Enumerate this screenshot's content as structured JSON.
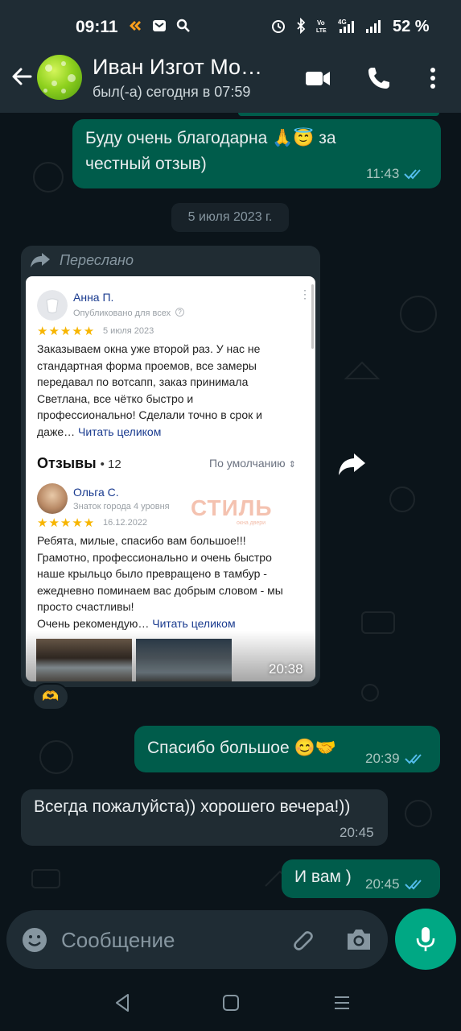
{
  "status_bar": {
    "time": "09:11",
    "battery": "52 %"
  },
  "header": {
    "contact_name": "Иван Изгот Мо…",
    "last_seen": "был(-а) сегодня в 07:59"
  },
  "messages": {
    "m1": {
      "text_line1": "Буду очень благодарна 🙏😇 за",
      "text_line2": "честный отзыв)",
      "time": "11:43"
    },
    "date_chip": "5 июля 2023 г.",
    "forwarded": {
      "label": "Переслано",
      "time": "20:38",
      "reaction": "🫶",
      "review1": {
        "name": "Анна П.",
        "published": "Опубликовано для всех",
        "stars": "★★★★★",
        "date": "5 июля 2023",
        "lines": [
          "Заказываем окна уже второй раз. У нас не",
          "стандартная форма проемов, все замеры",
          "передавал по вотсапп, заказ принимала",
          "Светлана, все чётко быстро и",
          "профессионально! Сделали точно в срок и"
        ],
        "last_line": "даже…",
        "read_more": "Читать целиком"
      },
      "reviews_heading": "Отзывы",
      "reviews_count": "• 12",
      "sort_label": "По умолчанию",
      "review2": {
        "name": "Ольга С.",
        "badge": "Знаток города 4 уровня",
        "stars": "★★★★★",
        "date": "16.12.2022",
        "lines": [
          "Ребята, милые, спасибо вам большое!!!",
          "Грамотно, профессионально и очень быстро",
          "наше крыльцо было превращено в тамбур -",
          "ежедневно поминаем вас добрым словом - мы",
          "просто счастливы!"
        ],
        "last_line": "Очень рекомендую…",
        "read_more": "Читать целиком"
      },
      "watermark": "СТИЛЬ",
      "watermark_sub": "окна двери"
    },
    "m3": {
      "text": "Спасибо большое 😊🤝",
      "time": "20:39"
    },
    "m4": {
      "text": "Всегда пожалуйста)) хорошего вечера!))",
      "time": "20:45"
    },
    "m5": {
      "text": "И вам )",
      "time": "20:45"
    }
  },
  "input": {
    "placeholder": "Сообщение"
  },
  "colors": {
    "outgoing": "#005c4b",
    "incoming": "#202c33",
    "header": "#1f2c34",
    "accent": "#00a884",
    "ticks": "#53bdeb"
  }
}
